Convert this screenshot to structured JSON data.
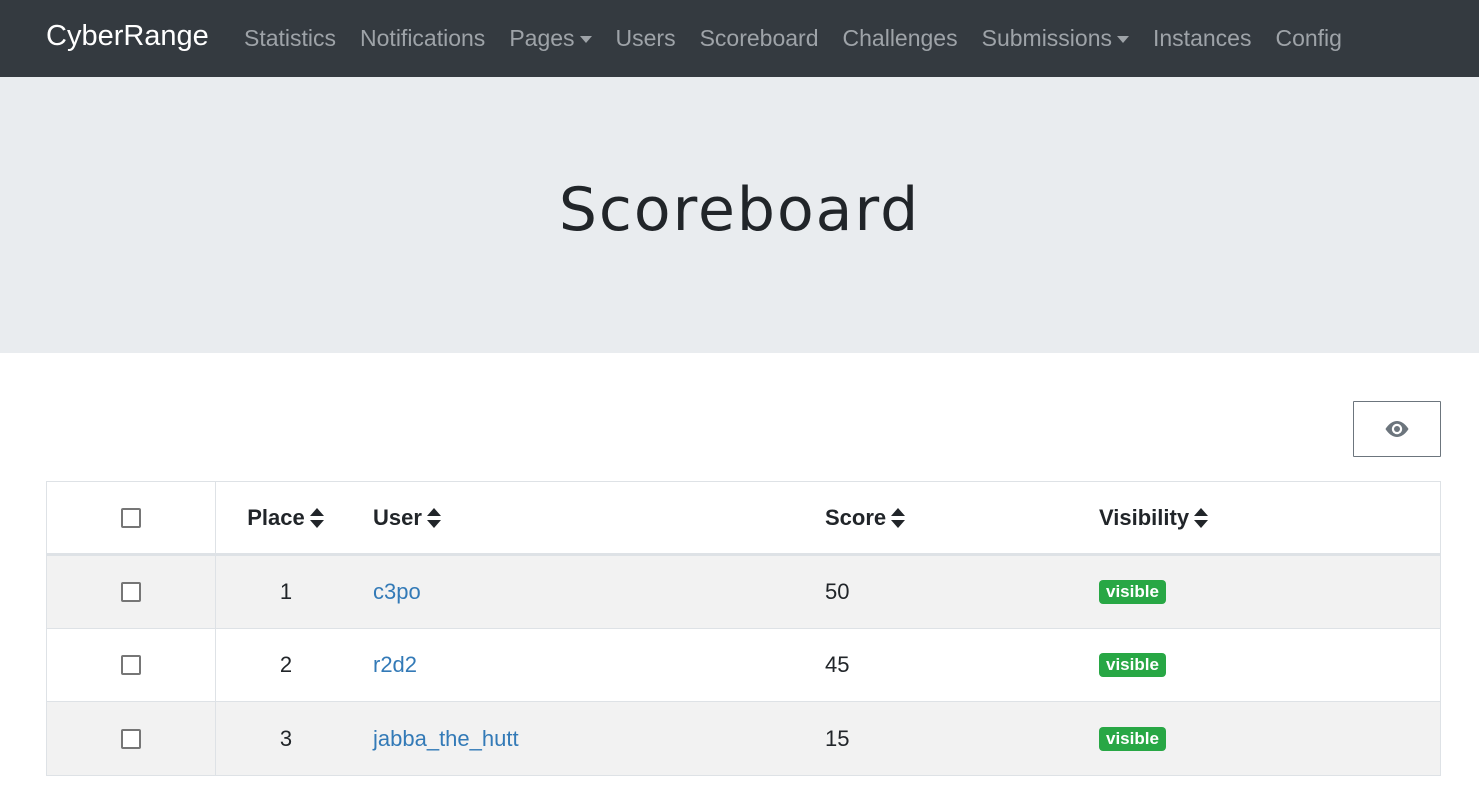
{
  "navbar": {
    "brand": "CyberRange",
    "items": [
      {
        "label": "Statistics",
        "dropdown": false
      },
      {
        "label": "Notifications",
        "dropdown": false
      },
      {
        "label": "Pages",
        "dropdown": true
      },
      {
        "label": "Users",
        "dropdown": false
      },
      {
        "label": "Scoreboard",
        "dropdown": false
      },
      {
        "label": "Challenges",
        "dropdown": false
      },
      {
        "label": "Submissions",
        "dropdown": true
      },
      {
        "label": "Instances",
        "dropdown": false
      },
      {
        "label": "Config",
        "dropdown": false
      }
    ]
  },
  "jumbotron": {
    "title": "Scoreboard"
  },
  "toolbar": {
    "visibility_toggle_icon": "eye-icon"
  },
  "table": {
    "headers": {
      "place": "Place",
      "user": "User",
      "score": "Score",
      "visibility": "Visibility"
    },
    "rows": [
      {
        "place": "1",
        "user": "c3po",
        "score": "50",
        "visibility": "visible"
      },
      {
        "place": "2",
        "user": "r2d2",
        "score": "45",
        "visibility": "visible"
      },
      {
        "place": "3",
        "user": "jabba_the_hutt",
        "score": "15",
        "visibility": "visible"
      }
    ]
  },
  "colors": {
    "navbar_bg": "#343a40",
    "jumbotron_bg": "#e9ecef",
    "link": "#337ab7",
    "badge_success": "#28a745"
  }
}
